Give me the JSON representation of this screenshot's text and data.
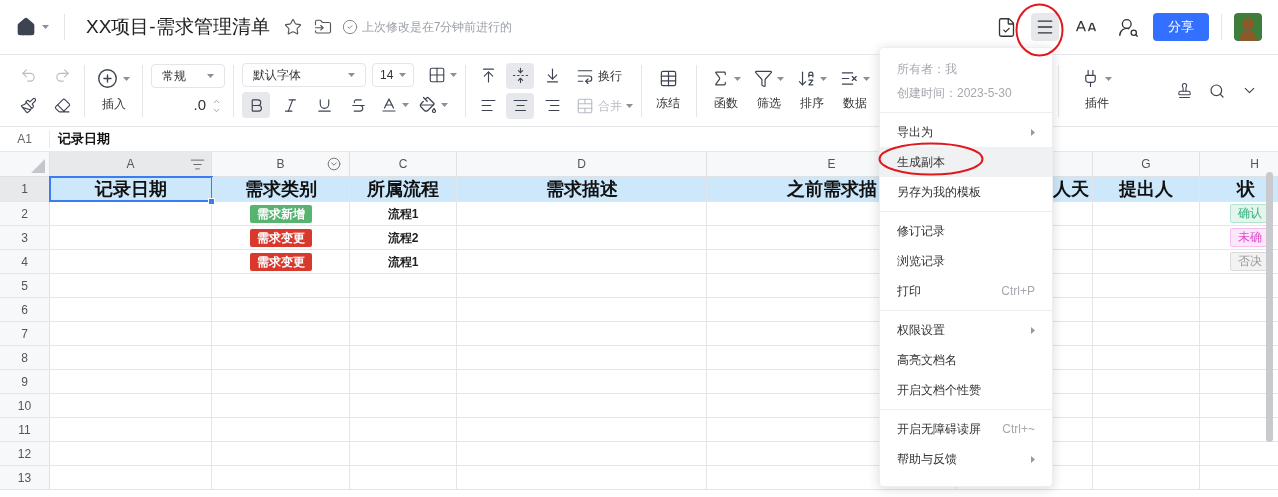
{
  "top_bar": {
    "title": "XX项目-需求管理清单",
    "save_status": "上次修改是在7分钟前进行的",
    "share": "分享",
    "menu_active": true
  },
  "toolbar": {
    "undo": {
      "disabled": true
    },
    "redo": {
      "disabled": true
    },
    "insert": "插入",
    "number_format": "常规",
    "decimal": ".0",
    "font": "默认字体",
    "font_size": "14",
    "text_styles": [
      {
        "kind": "bold",
        "selected": true
      },
      {
        "kind": "italic",
        "selected": false
      },
      {
        "kind": "underline",
        "selected": false
      },
      {
        "kind": "strike",
        "selected": false
      },
      {
        "kind": "font-color"
      },
      {
        "kind": "fill"
      }
    ],
    "valign": [
      {
        "kind": "top",
        "selected": false
      },
      {
        "kind": "middle",
        "selected": true
      },
      {
        "kind": "bottom",
        "selected": false
      }
    ],
    "halign": [
      {
        "kind": "left",
        "selected": false
      },
      {
        "kind": "center",
        "selected": true
      },
      {
        "kind": "right",
        "selected": false
      }
    ],
    "wrap": "换行",
    "merge": {
      "label": "合并",
      "disabled": true
    },
    "tools": [
      {
        "kind": "freeze",
        "label": "冻结"
      },
      {
        "kind": "function",
        "label": "函数"
      },
      {
        "kind": "filter",
        "label": "筛选"
      },
      {
        "kind": "sort",
        "label": "排序"
      },
      {
        "kind": "data",
        "label": "数据"
      }
    ],
    "plugin": "插件"
  },
  "formula_bar": {
    "cell": "A1",
    "value": "记录日期"
  },
  "sheet": {
    "columns": [
      {
        "label": "A",
        "selected": true,
        "kind": "filter"
      },
      {
        "label": "B",
        "selected": false,
        "kind": "dropdown"
      },
      {
        "label": "C",
        "selected": false,
        "kind": "plain"
      },
      {
        "label": "D",
        "selected": false,
        "kind": "plain"
      },
      {
        "label": "E",
        "selected": false,
        "kind": "plain"
      },
      {
        "selected": false,
        "kind": "plain"
      },
      {
        "label": "G",
        "selected": false,
        "kind": "plain"
      },
      {
        "label": "H",
        "selected": false,
        "kind": "plain"
      }
    ],
    "rows": [
      {
        "number": "1",
        "selected": true,
        "kind": "heading",
        "cells": [
          "记录日期",
          "需求类别",
          "所属流程",
          "需求描述",
          "之前需求描",
          "人天",
          "提出人",
          "状"
        ]
      },
      {
        "number": "2",
        "selected": false,
        "kind": "data",
        "category": {
          "text": "需求新增",
          "color": "#57b36f"
        },
        "process": "流程1",
        "status": {
          "text": "确认",
          "color": "#2fb37a"
        }
      },
      {
        "number": "3",
        "selected": false,
        "kind": "data",
        "category": {
          "text": "需求变更",
          "color": "#d9382d"
        },
        "process": "流程2",
        "status": {
          "text": "未确",
          "color": "#e04ad0"
        }
      },
      {
        "number": "4",
        "selected": false,
        "kind": "data",
        "category": {
          "text": "需求变更",
          "color": "#d9382d"
        },
        "process": "流程1",
        "status": {
          "text": "否决",
          "color": "#9a9a9a"
        }
      },
      {
        "number": "5",
        "selected": false,
        "kind": "empty"
      },
      {
        "number": "6",
        "selected": false,
        "kind": "empty"
      },
      {
        "number": "7",
        "selected": false,
        "kind": "empty"
      },
      {
        "number": "8",
        "selected": false,
        "kind": "empty"
      },
      {
        "number": "9",
        "selected": false,
        "kind": "empty"
      },
      {
        "number": "10",
        "selected": false,
        "kind": "empty"
      },
      {
        "number": "11",
        "selected": false,
        "kind": "empty"
      },
      {
        "number": "12",
        "selected": false,
        "kind": "empty"
      },
      {
        "number": "13",
        "selected": false,
        "kind": "empty"
      }
    ]
  },
  "more_menu": {
    "owner": "所有者：我",
    "created": "创建时间：2023-5-30",
    "sections": [
      [
        {
          "label": "导出为",
          "submenu": true,
          "selected": false
        },
        {
          "label": "生成副本",
          "submenu": false,
          "selected": true
        },
        {
          "label": "另存为我的模板",
          "submenu": false,
          "selected": false
        }
      ],
      [
        {
          "label": "修订记录",
          "submenu": false,
          "selected": false
        },
        {
          "label": "浏览记录",
          "submenu": false,
          "selected": false
        },
        {
          "label": "打印",
          "shortcut": "Ctrl+P",
          "submenu": false,
          "selected": false
        }
      ],
      [
        {
          "label": "权限设置",
          "submenu": true,
          "selected": false
        },
        {
          "label": "高亮文档名",
          "submenu": false,
          "selected": false
        },
        {
          "label": "开启文档个性赞",
          "submenu": false,
          "selected": false
        }
      ],
      [
        {
          "label": "开启无障碍读屏",
          "shortcut": "Ctrl+~",
          "submenu": false,
          "selected": false
        },
        {
          "label": "帮助与反馈",
          "submenu": true,
          "selected": false
        }
      ]
    ]
  }
}
